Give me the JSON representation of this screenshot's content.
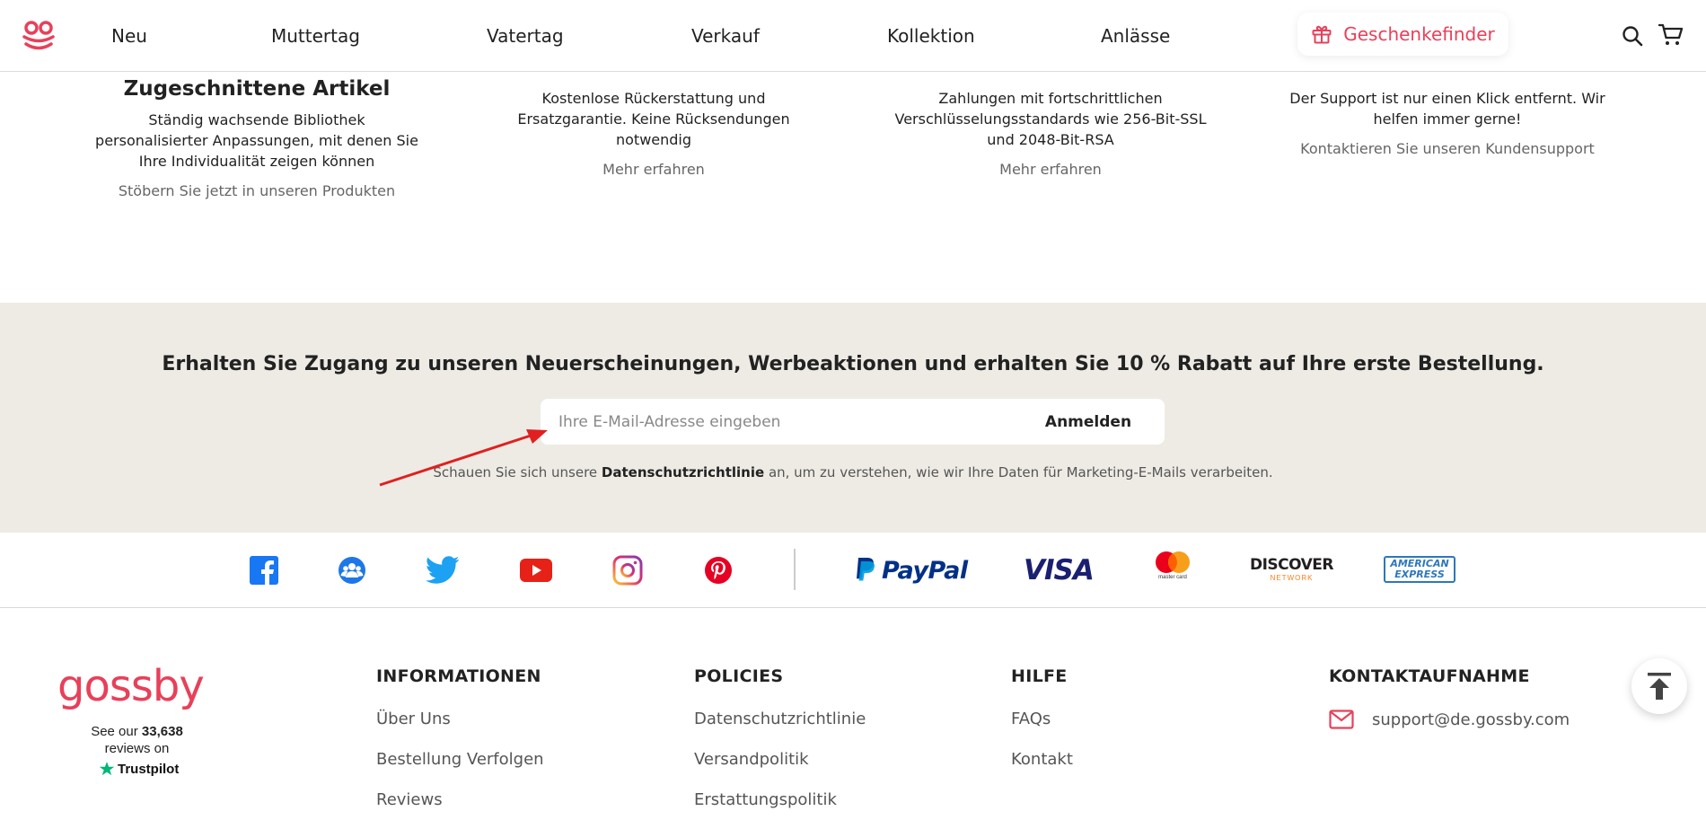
{
  "header": {
    "nav": [
      "Neu",
      "Muttertag",
      "Vatertag",
      "Verkauf",
      "Kollektion",
      "Anlässe"
    ],
    "gift_finder": "Geschenkefinder",
    "icons": [
      "gossby-logo-icon",
      "search-icon",
      "cart-icon",
      "gift-icon"
    ]
  },
  "features": [
    {
      "title": "Zugeschnittene Artikel",
      "text": [
        "Ständig wachsende Bibliothek",
        "personalisierter Anpassungen, mit denen Sie",
        "Ihre Individualität zeigen können"
      ],
      "link": "Stöbern Sie jetzt in unseren Produkten"
    },
    {
      "text": [
        "Kostenlose Rückerstattung und",
        "Ersatzgarantie. Keine Rücksendungen",
        "notwendig"
      ],
      "link": "Mehr erfahren"
    },
    {
      "text": [
        "Zahlungen mit fortschrittlichen",
        "Verschlüsselungsstandards wie 256-Bit-SSL",
        "und 2048-Bit-RSA"
      ],
      "link": "Mehr erfahren"
    },
    {
      "text": [
        "Der Support ist nur einen Klick entfernt. Wir",
        "helfen immer gerne!"
      ],
      "link": "Kontaktieren Sie unseren Kundensupport"
    }
  ],
  "newsletter": {
    "title": "Erhalten Sie Zugang zu unseren Neuerscheinungen, Werbeaktionen und erhalten Sie 10 % Rabatt auf Ihre erste Bestellung.",
    "placeholder": "Ihre E-Mail-Adresse eingeben",
    "submit": "Anmelden",
    "privacy_before": "Schauen Sie sich unsere",
    "privacy_link": "Datenschutzrichtlinie",
    "privacy_after": "an, um zu verstehen, wie wir Ihre Daten für Marketing-E-Mails verarbeiten."
  },
  "social": [
    "facebook-icon",
    "community-icon",
    "twitter-icon",
    "youtube-icon",
    "instagram-icon",
    "pinterest-icon"
  ],
  "payments": {
    "paypal": "PayPal",
    "visa": "VISA",
    "mastercard": "master card",
    "discover": "DISCOVER",
    "discover_sub": "NETWORK",
    "amex_top": "AMERICAN",
    "amex_bottom": "EXPRESS"
  },
  "brand": {
    "logo_text": "gossby",
    "trust_line1": "See our",
    "trust_count": "33,638",
    "trust_line2": "reviews on",
    "trustpilot": "Trustpilot"
  },
  "footer": {
    "columns": [
      {
        "title": "INFORMATIONEN",
        "links": [
          "Über Uns",
          "Bestellung Verfolgen",
          "Reviews"
        ]
      },
      {
        "title": "POLICIES",
        "links": [
          "Datenschutzrichtlinie",
          "Versandpolitik",
          "Erstattungspolitik"
        ]
      },
      {
        "title": "HILFE",
        "links": [
          "FAQs",
          "Kontakt"
        ]
      },
      {
        "title": "KONTAKTAUFNAHME",
        "email": "support@de.gossby.com"
      }
    ]
  },
  "colors": {
    "brand": "#e8405a",
    "newsletter_bg": "#eeebe5",
    "annotation_arrow": "#e02020"
  }
}
